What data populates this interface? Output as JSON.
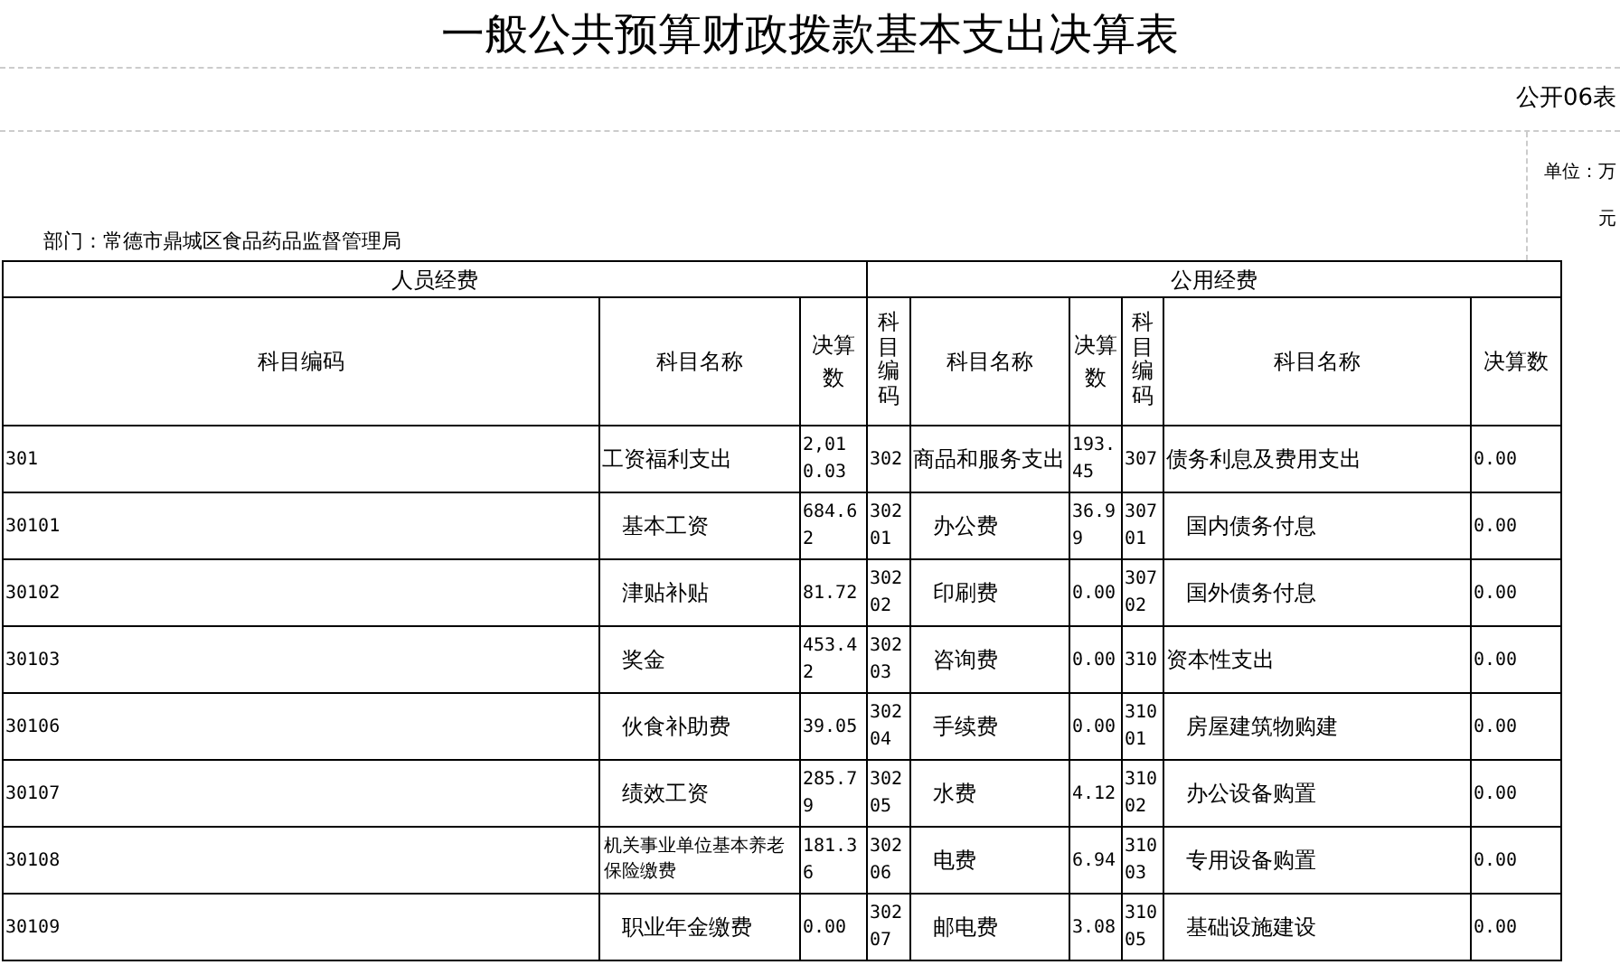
{
  "title": "一般公共预算财政拨款基本支出决算表",
  "form_number": "公开06表",
  "unit": "单位：万元",
  "department": "部门：常德市鼎城区食品药品监督管理局",
  "groups": [
    "人员经费",
    "公用经费"
  ],
  "columns": [
    {
      "label": "科目编码",
      "kind": "wide"
    },
    {
      "label": "科目名称",
      "kind": "wide"
    },
    {
      "label": "决算数",
      "kind": "wide"
    },
    {
      "label": "科目编码",
      "kind": "vertical"
    },
    {
      "label": "科目名称",
      "kind": "wide"
    },
    {
      "label": "决算数",
      "kind": "wide"
    },
    {
      "label": "科目编码",
      "kind": "vertical"
    },
    {
      "label": "科目名称",
      "kind": "wide"
    },
    {
      "label": "决算数",
      "kind": "wide"
    }
  ],
  "rows": [
    [
      {
        "code": "301",
        "name": "工资福利支出",
        "amount": "2,010.03",
        "kind": "category"
      },
      {
        "code": "302",
        "name": "商品和服务支出",
        "amount": "193.45",
        "kind": "category"
      },
      {
        "code": "307",
        "name": "债务利息及费用支出",
        "amount": "0.00",
        "kind": "category"
      }
    ],
    [
      {
        "code": "30101",
        "name": "基本工资",
        "amount": "684.62",
        "kind": "item"
      },
      {
        "code": "30201",
        "name": "办公费",
        "amount": "36.99",
        "kind": "item"
      },
      {
        "code": "30701",
        "name": "国内债务付息",
        "amount": "0.00",
        "kind": "item"
      }
    ],
    [
      {
        "code": "30102",
        "name": "津贴补贴",
        "amount": "81.72",
        "kind": "item"
      },
      {
        "code": "30202",
        "name": "印刷费",
        "amount": "0.00",
        "kind": "item"
      },
      {
        "code": "30702",
        "name": "国外债务付息",
        "amount": "0.00",
        "kind": "item"
      }
    ],
    [
      {
        "code": "30103",
        "name": "奖金",
        "amount": "453.42",
        "kind": "item"
      },
      {
        "code": "30203",
        "name": "咨询费",
        "amount": "0.00",
        "kind": "item"
      },
      {
        "code": "310",
        "name": "资本性支出",
        "amount": "0.00",
        "kind": "category"
      }
    ],
    [
      {
        "code": "30106",
        "name": "伙食补助费",
        "amount": "39.05",
        "kind": "item"
      },
      {
        "code": "30204",
        "name": "手续费",
        "amount": "0.00",
        "kind": "item"
      },
      {
        "code": "31001",
        "name": "房屋建筑物购建",
        "amount": "0.00",
        "kind": "item"
      }
    ],
    [
      {
        "code": "30107",
        "name": "绩效工资",
        "amount": "285.79",
        "kind": "item"
      },
      {
        "code": "30205",
        "name": "水费",
        "amount": "4.12",
        "kind": "item"
      },
      {
        "code": "31002",
        "name": "办公设备购置",
        "amount": "0.00",
        "kind": "item"
      }
    ],
    [
      {
        "code": "30108",
        "name": "机关事业单位基本养老保险缴费",
        "amount": "181.36",
        "kind": "small"
      },
      {
        "code": "30206",
        "name": "电费",
        "amount": "6.94",
        "kind": "item"
      },
      {
        "code": "31003",
        "name": "专用设备购置",
        "amount": "0.00",
        "kind": "item"
      }
    ],
    [
      {
        "code": "30109",
        "name": "职业年金缴费",
        "amount": "0.00",
        "kind": "item"
      },
      {
        "code": "30207",
        "name": "邮电费",
        "amount": "3.08",
        "kind": "item"
      },
      {
        "code": "31005",
        "name": "基础设施建设",
        "amount": "0.00",
        "kind": "item"
      }
    ]
  ]
}
